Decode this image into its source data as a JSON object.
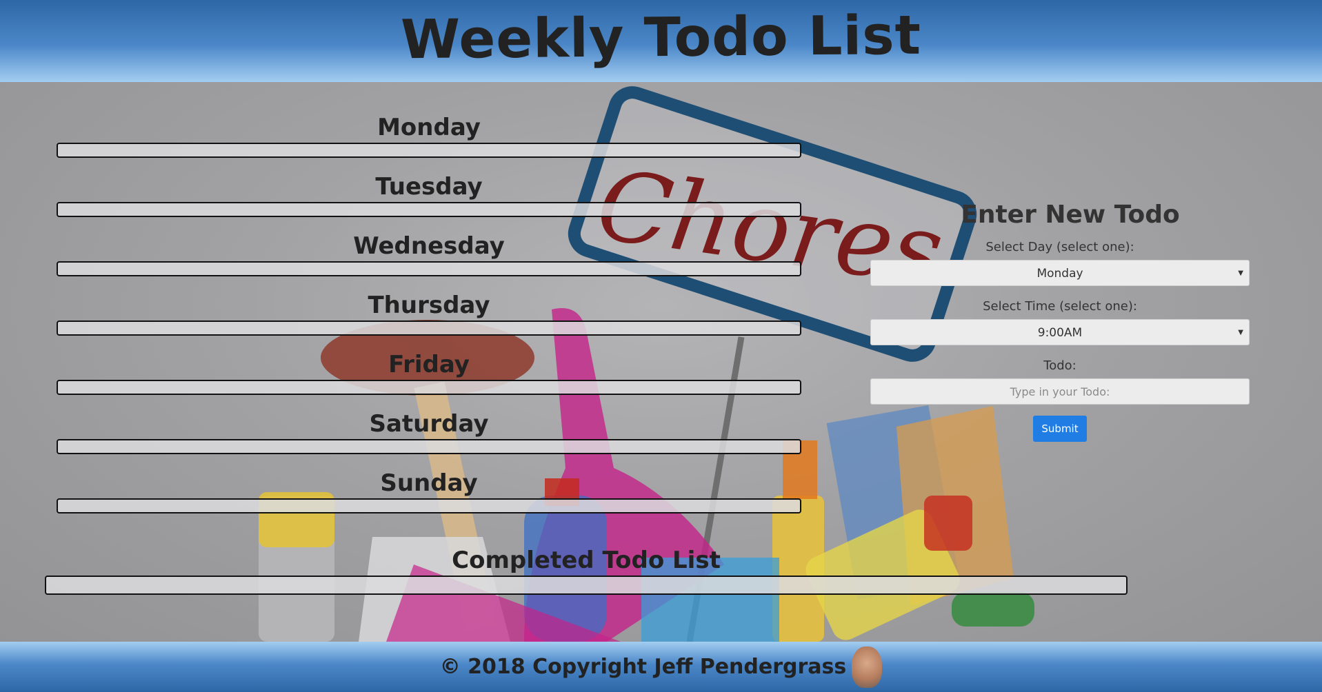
{
  "header": {
    "title": "Weekly Todo List"
  },
  "background": {
    "sign_text": "Chores"
  },
  "days": [
    {
      "label": "Monday"
    },
    {
      "label": "Tuesday"
    },
    {
      "label": "Wednesday"
    },
    {
      "label": "Thursday"
    },
    {
      "label": "Friday"
    },
    {
      "label": "Saturday"
    },
    {
      "label": "Sunday"
    }
  ],
  "completed": {
    "label": "Completed Todo List"
  },
  "form": {
    "title": "Enter New Todo",
    "day_label": "Select Day (select one):",
    "day_value": "Monday",
    "time_label": "Select Time (select one):",
    "time_value": "9:00AM",
    "todo_label": "Todo:",
    "todo_placeholder": "Type in your Todo:",
    "submit_label": "Submit"
  },
  "footer": {
    "copyright": "© 2018 Copyright Jeff Pendergrass"
  },
  "colors": {
    "header_blue": "#2e67a6",
    "header_light": "#a3cdf1",
    "submit_blue": "#1f7de3",
    "sign_frame": "#1f4e74",
    "sign_text": "#7a1c1c"
  }
}
